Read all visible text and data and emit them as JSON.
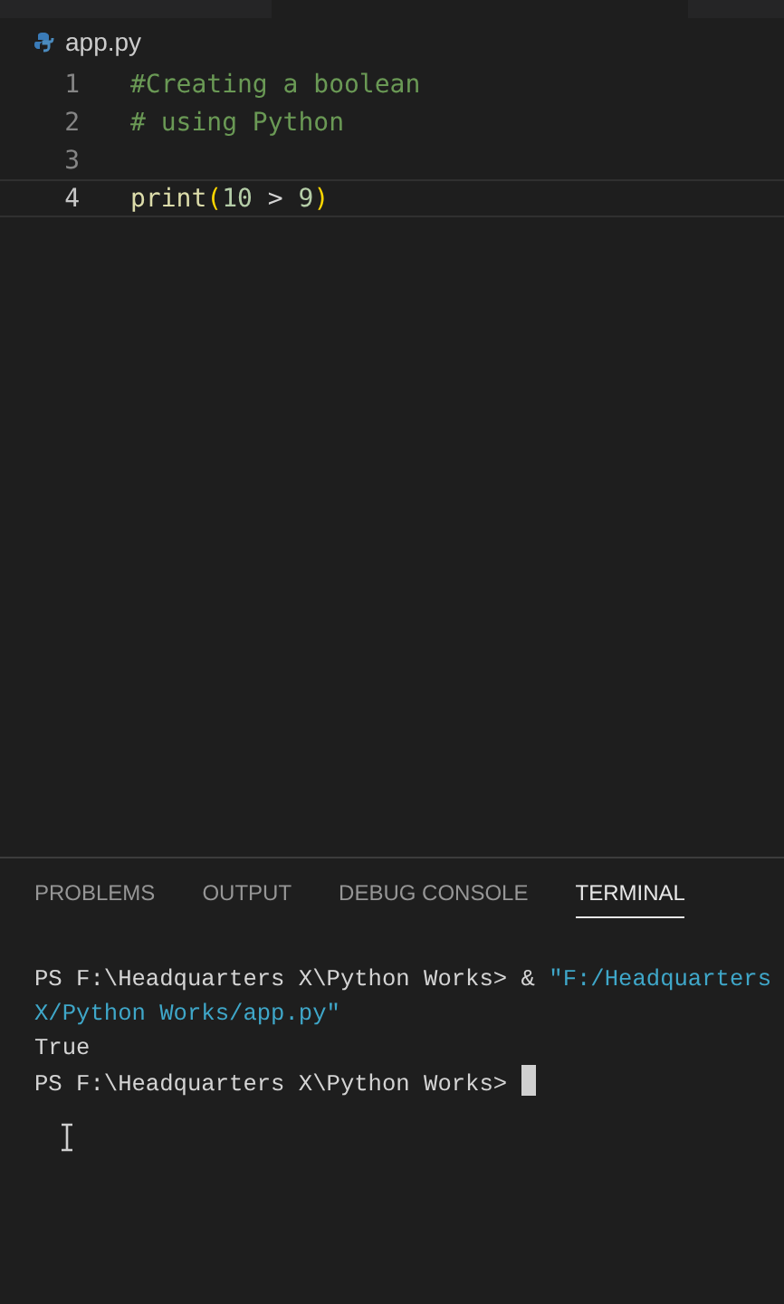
{
  "editor": {
    "breadcrumb": "app.py",
    "lines": [
      {
        "number": "1",
        "current": false,
        "tokens": [
          {
            "kind": "comment",
            "text": "#Creating a boolean"
          }
        ]
      },
      {
        "number": "2",
        "current": false,
        "tokens": [
          {
            "kind": "comment",
            "text": "# using Python"
          }
        ]
      },
      {
        "number": "3",
        "current": false
      },
      {
        "number": "4",
        "current": true,
        "tokens": [
          {
            "kind": "function",
            "text": "print"
          },
          {
            "kind": "bracket",
            "text": "("
          },
          {
            "kind": "number",
            "text": "10"
          },
          {
            "kind": "plain",
            "text": " > "
          },
          {
            "kind": "number",
            "text": "9"
          },
          {
            "kind": "bracket",
            "text": ")"
          }
        ]
      }
    ]
  },
  "panel": {
    "tabs": [
      {
        "label": "PROBLEMS",
        "selected": false
      },
      {
        "label": "OUTPUT",
        "selected": false
      },
      {
        "label": "DEBUG CONSOLE",
        "selected": false
      },
      {
        "label": "TERMINAL",
        "selected": true
      }
    ],
    "terminal": [
      [
        {
          "kind": "plain",
          "text": "PS F:\\Headquarters X\\Python Works> & "
        },
        {
          "kind": "string",
          "text": "\"F:/Headquarters"
        }
      ],
      [
        {
          "kind": "string",
          "text": "X/Python Works/app.py\""
        }
      ],
      [
        {
          "kind": "plain",
          "text": "True"
        }
      ],
      [
        {
          "kind": "plain",
          "text": "PS F:\\Headquarters X\\Python Works> "
        },
        {
          "kind": "cursor"
        }
      ]
    ]
  }
}
